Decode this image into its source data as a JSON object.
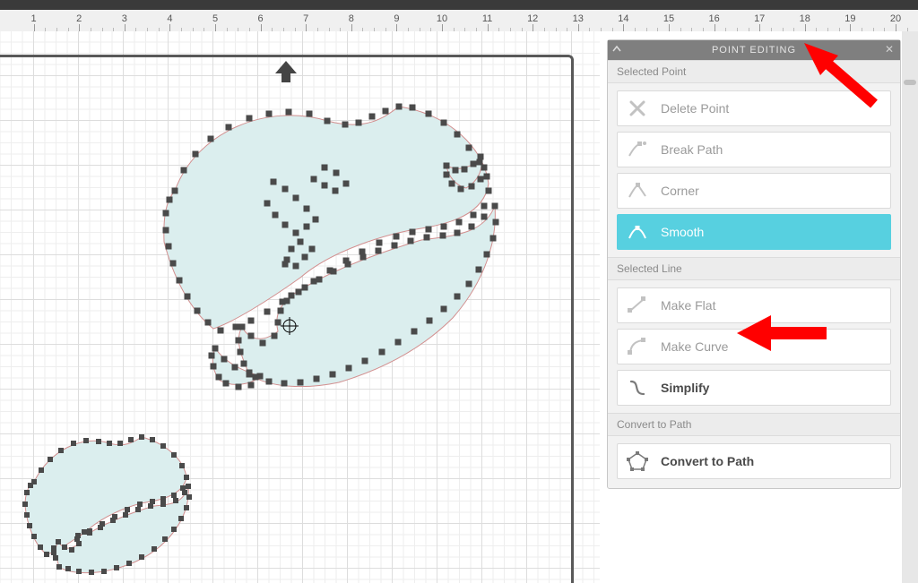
{
  "ruler": {
    "start": 1,
    "end": 20
  },
  "panel": {
    "title": "POINT EDITING",
    "sections": {
      "selected_point": {
        "label": "Selected Point",
        "items": {
          "delete_point": "Delete Point",
          "break_path": "Break Path",
          "corner": "Corner",
          "smooth": "Smooth"
        }
      },
      "selected_line": {
        "label": "Selected Line",
        "items": {
          "make_flat": "Make Flat",
          "make_curve": "Make Curve",
          "simplify": "Simplify"
        }
      },
      "convert_to_path": {
        "label": "Convert to Path",
        "items": {
          "convert": "Convert to Path"
        }
      }
    }
  }
}
